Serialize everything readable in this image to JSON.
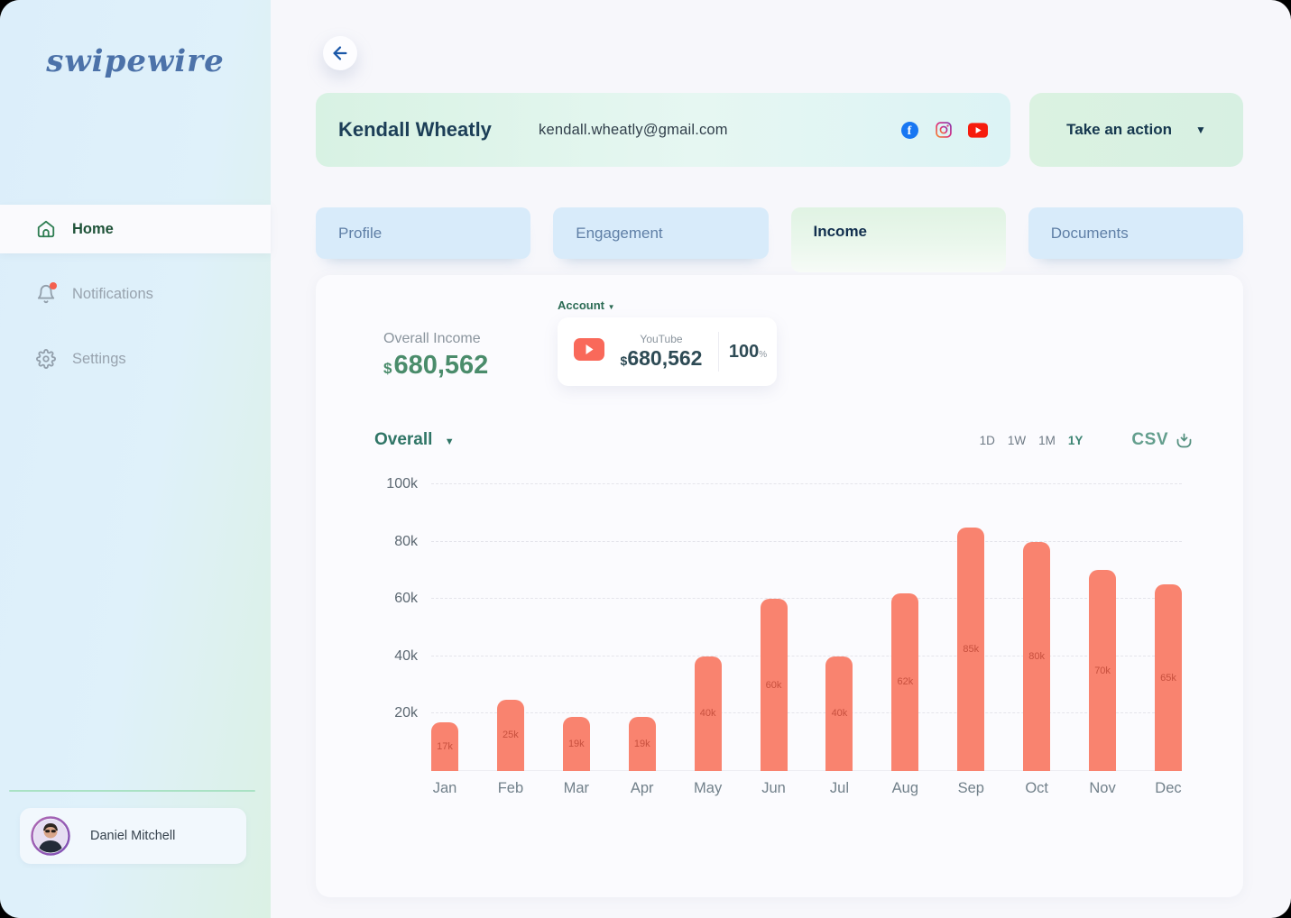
{
  "brand": {
    "name": "swipewire"
  },
  "sidebar": {
    "nav": [
      {
        "label": "Home"
      },
      {
        "label": "Notifications"
      },
      {
        "label": "Settings"
      }
    ],
    "user": {
      "name": "Daniel Mitchell"
    }
  },
  "header": {
    "name": "Kendall Wheatly",
    "email": "kendall.wheatly@gmail.com",
    "socials": [
      "facebook",
      "instagram",
      "youtube"
    ],
    "action_label": "Take an action"
  },
  "tabs": [
    {
      "label": "Profile"
    },
    {
      "label": "Engagement"
    },
    {
      "label": "Income"
    },
    {
      "label": "Documents"
    }
  ],
  "active_tab": "Income",
  "income": {
    "overall_label": "Overall Income",
    "currency": "$",
    "overall_value": "680,562",
    "account_label": "Account",
    "account_card": {
      "platform": "YouTube",
      "currency": "$",
      "value": "680,562",
      "percent": "100",
      "percent_unit": "%"
    }
  },
  "chart_controls": {
    "series_label": "Overall",
    "ranges": [
      "1D",
      "1W",
      "1M",
      "1Y"
    ],
    "active_range": "1Y",
    "export_label": "CSV"
  },
  "chart_data": {
    "type": "bar",
    "categories": [
      "Jan",
      "Feb",
      "Mar",
      "Apr",
      "May",
      "Jun",
      "Jul",
      "Aug",
      "Sep",
      "Oct",
      "Nov",
      "Dec"
    ],
    "values": [
      17000,
      25000,
      19000,
      19000,
      40000,
      60000,
      40000,
      62000,
      85000,
      80000,
      70000,
      65000
    ],
    "bar_labels": [
      "17k",
      "25k",
      "19k",
      "19k",
      "40k",
      "60k",
      "40k",
      "62k",
      "85k",
      "80k",
      "70k",
      "65k"
    ],
    "ytick_values": [
      20000,
      40000,
      60000,
      80000,
      100000
    ],
    "ytick_labels": [
      "20k",
      "40k",
      "60k",
      "80k",
      "100k"
    ],
    "ylim": [
      0,
      100000
    ],
    "grid": "horizontal-dashed",
    "legend": "none",
    "bar_color": "#F9836F",
    "bar_label_color": "#C7503E"
  },
  "colors": {
    "accent_teal": "#2F7566",
    "value_green": "#4A8C6B",
    "navy": "#15374E",
    "bar": "#F9836F",
    "facebook_blue": "#1877F2",
    "youtube_red": "#F61C0D"
  }
}
